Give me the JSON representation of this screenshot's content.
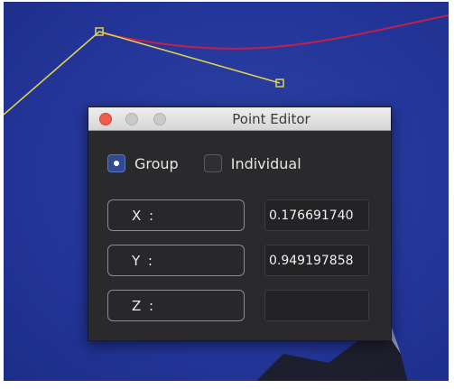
{
  "canvas": {
    "background_color": "#24369a",
    "curves": [
      {
        "name": "yellow-curve",
        "color": "#e0d24a"
      },
      {
        "name": "red-curve",
        "color": "#c21f4a"
      }
    ]
  },
  "window": {
    "title": "Point Editor",
    "controls": [
      "close-icon",
      "minimize-icon",
      "zoom-icon"
    ]
  },
  "mode": {
    "options": [
      {
        "label": "Group",
        "selected": true
      },
      {
        "label": "Individual",
        "selected": false
      }
    ]
  },
  "fields": [
    {
      "axis": "X :",
      "value": "0.176691740"
    },
    {
      "axis": "Y :",
      "value": "0.949197858"
    },
    {
      "axis": "Z :",
      "value": ""
    }
  ]
}
